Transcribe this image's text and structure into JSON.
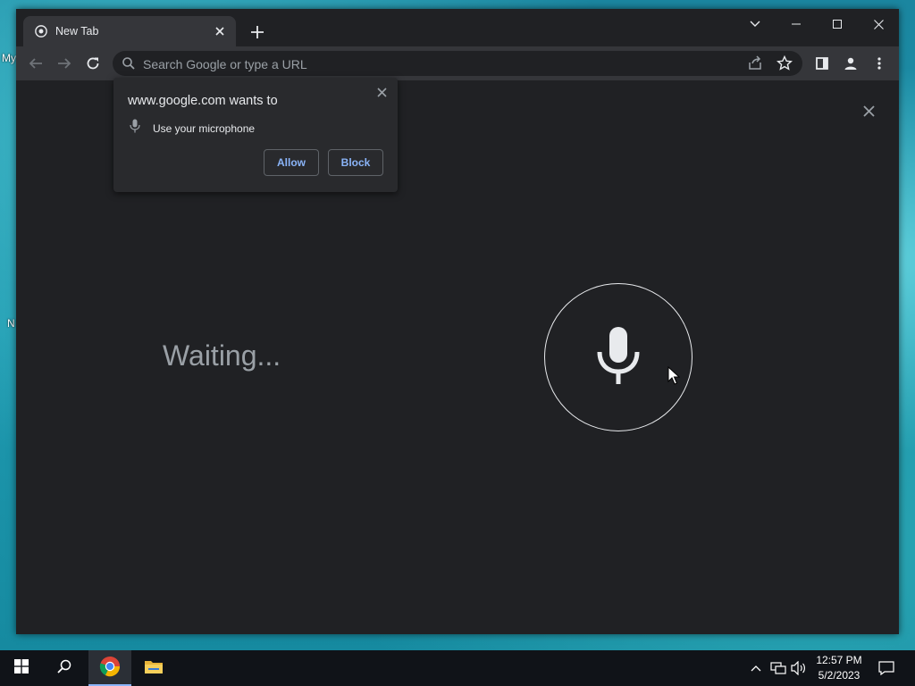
{
  "browser": {
    "tab": {
      "title": "New Tab"
    },
    "omnibox": {
      "placeholder": "Search Google or type a URL"
    }
  },
  "permission_popup": {
    "title": "www.google.com wants to",
    "permission": "Use your microphone",
    "allow_label": "Allow",
    "block_label": "Block"
  },
  "voice_search": {
    "status": "Waiting..."
  },
  "desktop": {
    "labels": [
      "My",
      "N"
    ]
  },
  "taskbar": {
    "time": "12:57 PM",
    "date": "5/2/2023"
  },
  "colors": {
    "window_bg": "#202124",
    "toolbar_bg": "#35363a",
    "link_blue": "#8ab4f8",
    "text_primary": "#e8eaed",
    "text_secondary": "#9aa0a6"
  }
}
